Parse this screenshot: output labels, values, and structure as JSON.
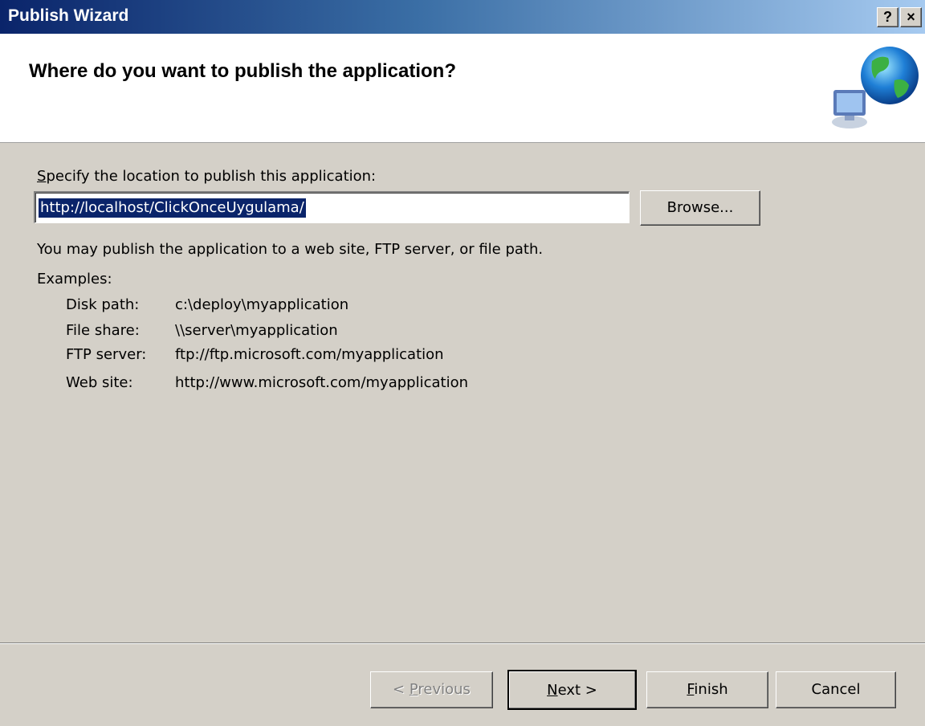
{
  "window": {
    "title": "Publish Wizard",
    "help_label": "?",
    "close_label": "×"
  },
  "header": {
    "title": "Where do you want to publish the application?",
    "icon": "network-globe-icon"
  },
  "location": {
    "label": "Specify the location to publish this application:",
    "value": "http://localhost/ClickOnceUygulama/",
    "browse_label": "Browse..."
  },
  "info": {
    "description": "You may publish the application to a web site, FTP server, or file path.",
    "examples_label": "Examples:",
    "examples": [
      {
        "name": "Disk path:",
        "value": "c:\\deploy\\myapplication"
      },
      {
        "name": "File share:",
        "value": "\\\\server\\myapplication"
      },
      {
        "name": "FTP server:",
        "value": "ftp://ftp.microsoft.com/myapplication"
      },
      {
        "name": "Web site:",
        "value": "http://www.microsoft.com/myapplication"
      }
    ]
  },
  "footer": {
    "previous_prefix": "< ",
    "previous_key": "P",
    "previous_rest": "revious",
    "next_key": "N",
    "next_rest": "ext >",
    "finish_key": "F",
    "finish_rest": "inish",
    "cancel_label": "Cancel"
  },
  "colors": {
    "titlebar_start": "#0a246a",
    "titlebar_end": "#a6caf0",
    "dialog_face": "#d4d0c8",
    "selection": "#0a246a"
  }
}
